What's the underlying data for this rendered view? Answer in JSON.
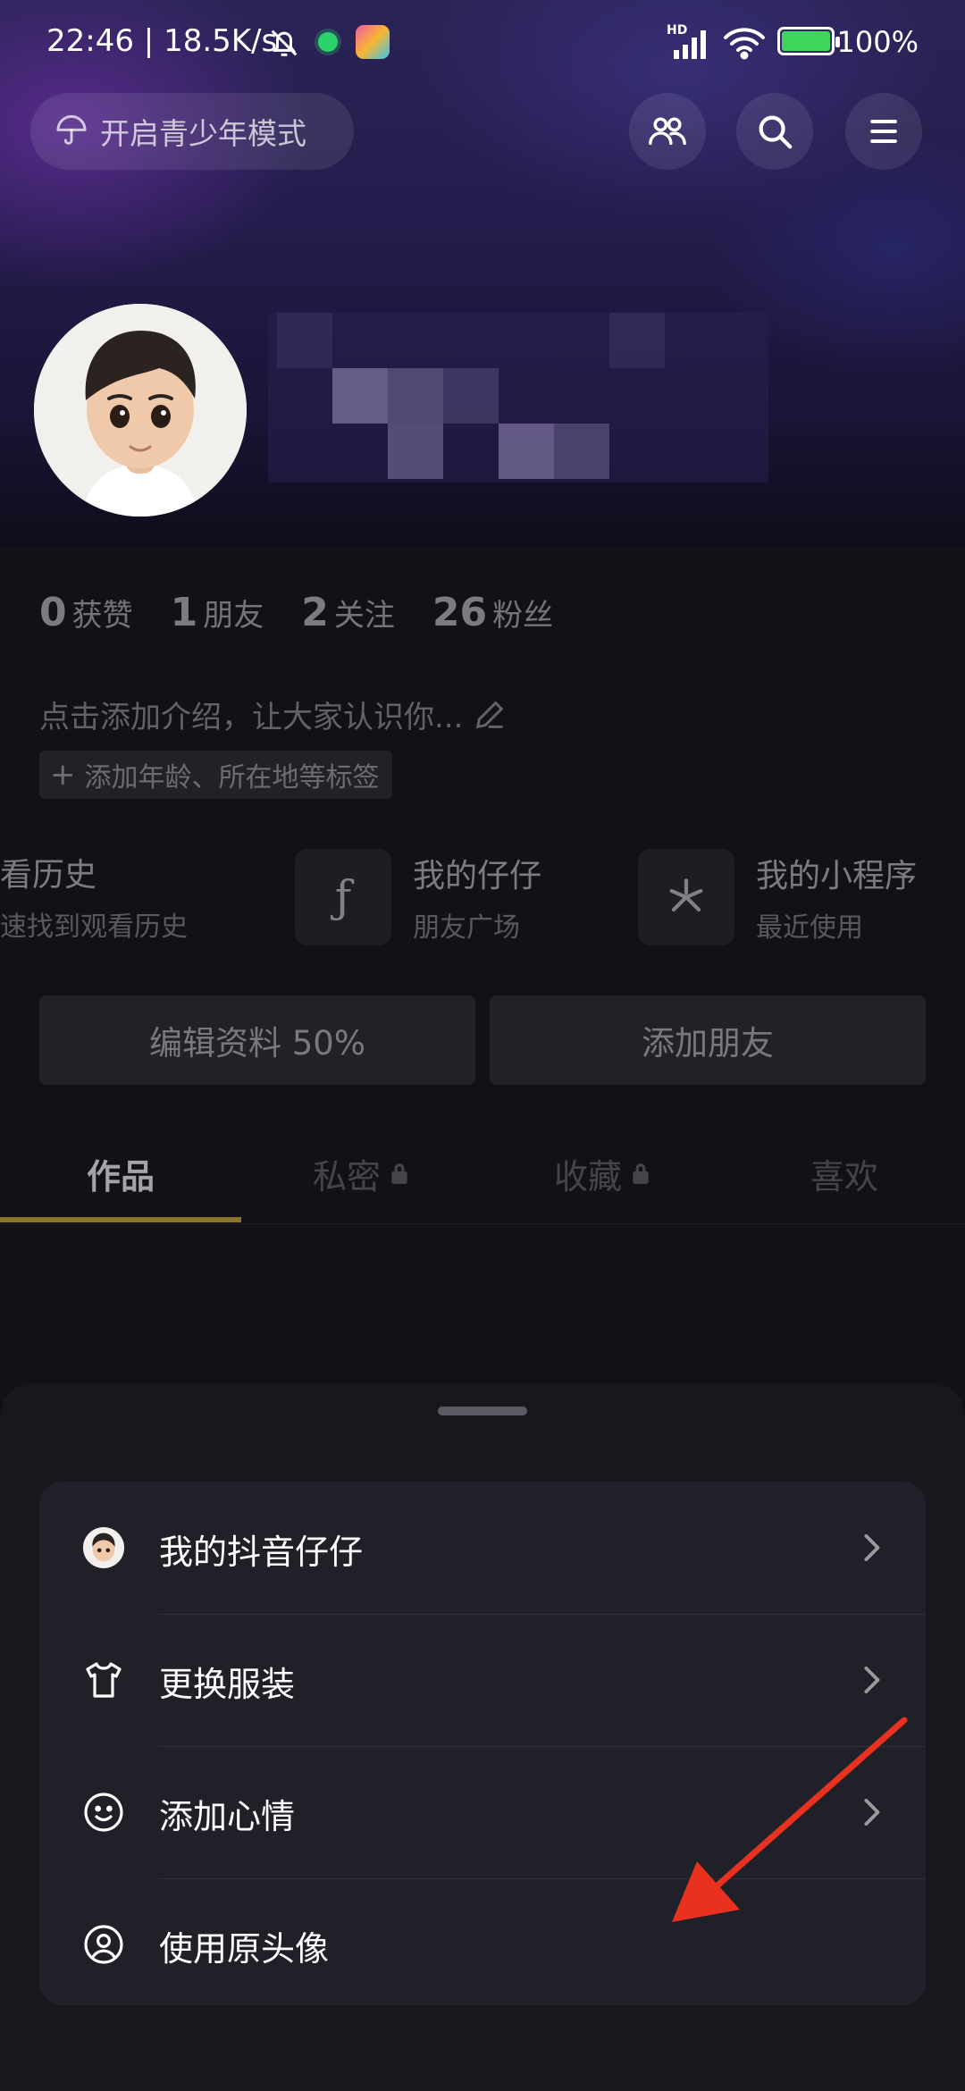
{
  "status_bar": {
    "time": "22:46",
    "speed": "18.5K/s",
    "battery": "100%",
    "network_label": "HD"
  },
  "header": {
    "teen_mode_label": "开启青少年模式",
    "icons": [
      "umbrella-icon",
      "friends-icon",
      "search-icon",
      "menu-icon"
    ]
  },
  "profile": {
    "stats": [
      {
        "value": "0",
        "label": "获赞"
      },
      {
        "value": "1",
        "label": "朋友"
      },
      {
        "value": "2",
        "label": "关注"
      },
      {
        "value": "26",
        "label": "粉丝"
      }
    ],
    "bio_placeholder": "点击添加介绍，让大家认识你...",
    "tag_label": "添加年龄、所在地等标签"
  },
  "shortcuts": [
    {
      "title": "看历史",
      "subtitle": "速找到观看历史"
    },
    {
      "title": "我的仔仔",
      "subtitle": "朋友广场",
      "icon": "zaizai-icon"
    },
    {
      "title": "我的小程序",
      "subtitle": "最近使用",
      "icon": "mini-program-icon"
    }
  ],
  "actions": {
    "edit_profile": "编辑资料 50%",
    "add_friend": "添加朋友"
  },
  "tabs": [
    "作品",
    "私密",
    "收藏",
    "喜欢"
  ],
  "sheet": {
    "items": [
      {
        "label": "我的抖音仔仔",
        "icon": "avatar-small-icon",
        "has_chevron": true
      },
      {
        "label": "更换服装",
        "icon": "tshirt-icon",
        "has_chevron": true
      },
      {
        "label": "添加心情",
        "icon": "smile-icon",
        "has_chevron": true
      },
      {
        "label": "使用原头像",
        "icon": "user-circle-icon",
        "has_chevron": false
      }
    ]
  },
  "colors": {
    "annotation_arrow": "#e8321f",
    "tab_underline": "#8a7528",
    "sheet_bg": "#17171e",
    "card_bg": "#202029"
  }
}
